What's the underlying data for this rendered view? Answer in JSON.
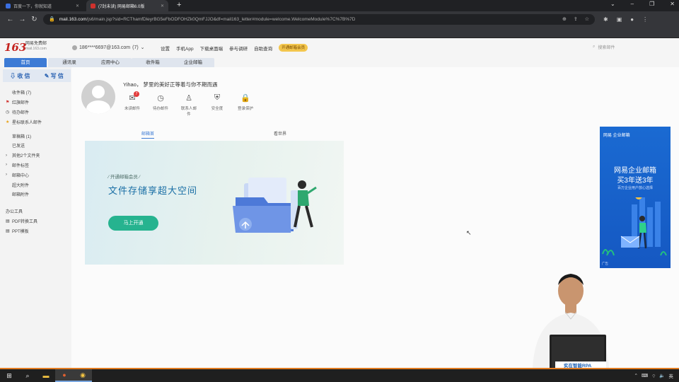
{
  "browser": {
    "tabs": [
      {
        "title": "百度一下，你就知道",
        "favicon_color": "#3b6fe0",
        "active": false
      },
      {
        "title": "(7封未读) 网易邮箱6.0版",
        "favicon_color": "#d0312d",
        "active": true
      }
    ],
    "url_host": "mail.163.com",
    "url_path": "/js6/main.jsp?sid=RCThamfDleyrBG5eFbODFOHZk0QmFJJO&df=mail163_letter#module=welcome.WelcomeModule%7C%7B%7D"
  },
  "mail": {
    "logo_number": "163",
    "logo_name": "网易免费邮",
    "logo_domain": "mail.163.com",
    "account": "186****6697@163.com",
    "account_count": "(7)",
    "top_links": [
      "设置",
      "手机App",
      "下载桌面端",
      "参与调研",
      "自助查询"
    ],
    "vip_badge": "开通邮箱会员",
    "search_placeholder": "搜索邮件",
    "nav_tabs": [
      "首页",
      "通讯录",
      "应用中心",
      "收件箱",
      "企业邮箱"
    ],
    "compose_receive": "收 信",
    "compose_write": "写 信",
    "folders": [
      {
        "label": "收件箱 (7)",
        "icon": ""
      },
      {
        "label": "红旗邮件",
        "icon": "⚑"
      },
      {
        "label": "待办邮件",
        "icon": "◷"
      },
      {
        "label": "星标联系人邮件",
        "icon": "★"
      },
      {
        "label": "草稿箱 (1)",
        "icon": ""
      },
      {
        "label": "已发送",
        "icon": ""
      },
      {
        "label": "其他2个文件夹",
        "icon": "›"
      },
      {
        "label": "邮件标签",
        "icon": "›"
      },
      {
        "label": "邮箱中心",
        "icon": "›"
      },
      {
        "label": "超大附件",
        "icon": ""
      },
      {
        "label": "邮箱附件",
        "icon": ""
      }
    ],
    "tools_header": "办公工具",
    "tools": [
      {
        "label": "PDF转换工具",
        "icon": "▤"
      },
      {
        "label": "PPT模板",
        "icon": "▤"
      }
    ],
    "greeting": "Yihao， 梦里的美好正等着与你不期而遇",
    "quick_items": [
      {
        "label": "未读邮件",
        "icon": "✉",
        "badge": "7"
      },
      {
        "label": "待办邮件",
        "icon": "◷",
        "badge": ""
      },
      {
        "label": "联系人邮件",
        "icon": "♙",
        "badge": ""
      },
      {
        "label": "安全度",
        "icon": "⛨",
        "badge": ""
      },
      {
        "label": "登录保护",
        "icon": "🔒",
        "badge": ""
      }
    ],
    "sub_tabs": [
      "邮箱首",
      "看世界"
    ],
    "banner": {
      "tag": "开通邮箱会员",
      "title": "文件存储享超大空间",
      "button": "马上开通"
    },
    "ad": {
      "brand": "网易 企业邮箱",
      "line1": "网易企业邮箱",
      "line2": "买3年送3年",
      "sub": "百万企业用户放心选择",
      "tag": "广告"
    }
  },
  "presenter_caption": "实在智能RPA",
  "taskbar": {
    "tray_text": "英"
  }
}
